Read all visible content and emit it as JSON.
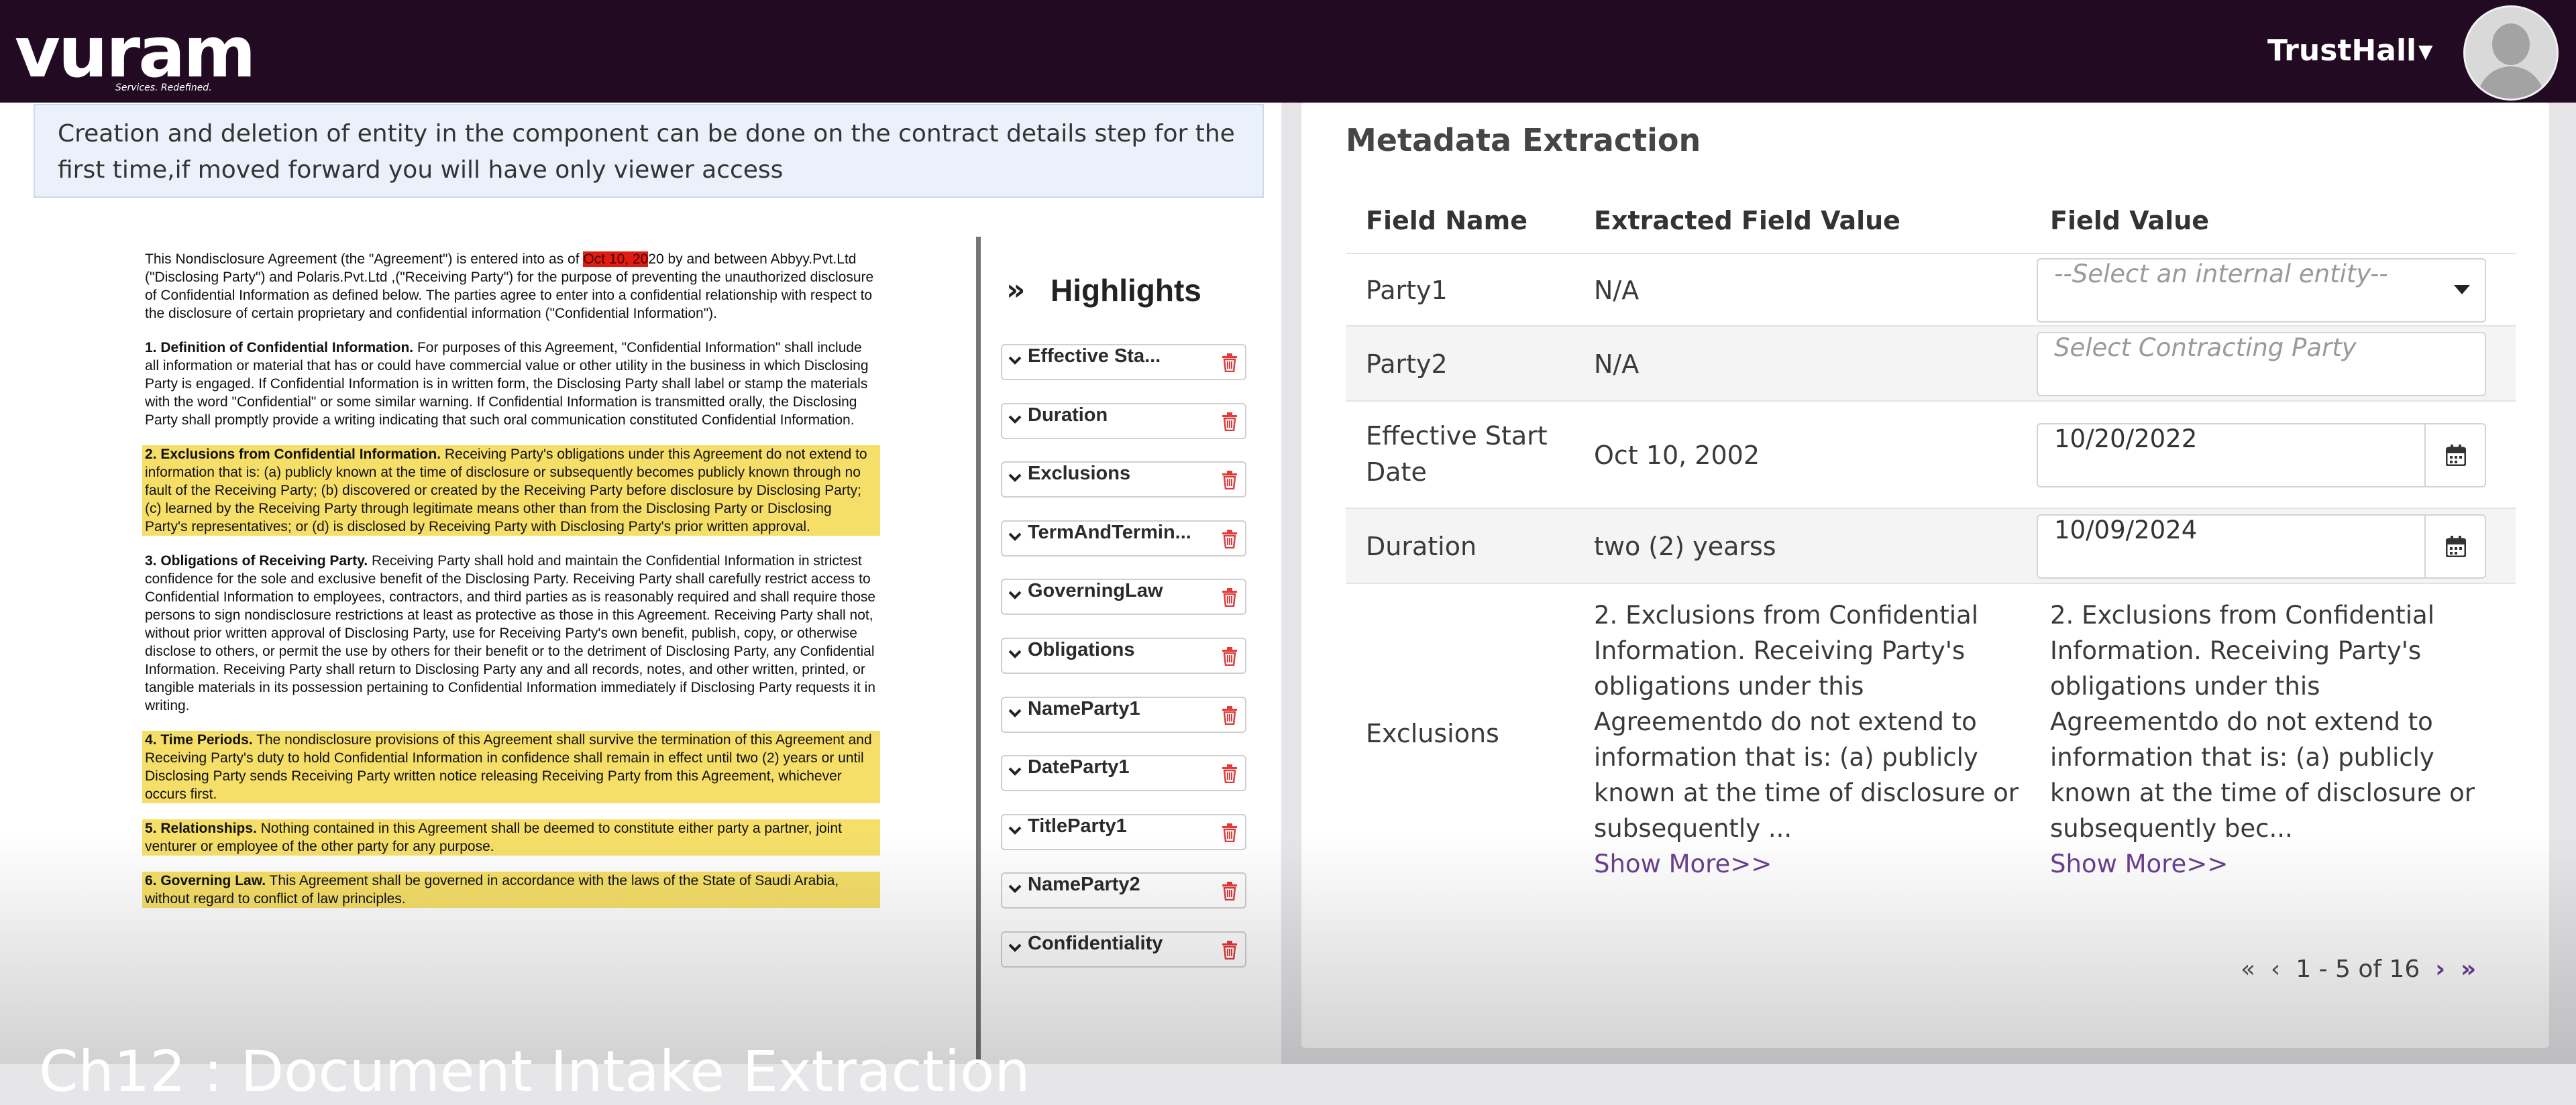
{
  "header": {
    "logo_text": "vuram",
    "logo_tagline": "Services. Redefined.",
    "user_name": "TrustHall"
  },
  "banner": {
    "text": "Creation and deletion of entity in the component can be done on the contract details step for the first time,if moved forward you will have only viewer access"
  },
  "document": {
    "intro_a": "This Nondisclosure Agreement (the \"Agreement\") is entered into as of ",
    "intro_date": "Oct 10, 20",
    "intro_b": "20 by and between Abbyy.Pvt.Ltd (\"Disclosing Party\") and Polaris.Pvt.Ltd ,(\"Receiving Party\") for the purpose of preventing the unauthorized disclosure of Confidential Information as defined below. The parties agree to enter into a confidential relationship with respect to the disclosure of certain proprietary and confidential information (\"Confidential Information\").",
    "s1_title": "1. Definition of Confidential Information.",
    "s1_body": " For purposes of this Agreement, \"Confidential Information\" shall include all information or material that has or could have commercial value or other utility in the business in which Disclosing Party is engaged. If Confidential Information is in written form, the Disclosing Party shall label or stamp the materials with the word \"Confidential\" or some similar warning. If Confidential Information is transmitted orally, the Disclosing Party shall promptly provide a writing indicating that such oral communication constituted Confidential Information.",
    "s2_title": "2. Exclusions from Confidential Information.",
    "s2_body": " Receiving Party's obligations under this Agreement do not extend to information that is: (a) publicly known at the time of disclosure or subsequently becomes publicly known through no fault of the Receiving Party; (b) discovered or created by the Receiving Party before disclosure by Disclosing Party; (c) learned by the Receiving Party through legitimate means other than from the Disclosing Party or Disclosing Party's representatives; or (d) is disclosed by Receiving Party with Disclosing Party's prior written approval.",
    "s3_title": "3. Obligations of Receiving Party.",
    "s3_body": " Receiving Party shall hold and maintain the Confidential Information in strictest confidence for the sole and exclusive benefit of the Disclosing Party. Receiving Party shall carefully restrict access to Confidential Information to employees, contractors, and third parties as is reasonably required and shall require those persons to sign nondisclosure restrictions at least as protective as those in this Agreement. Receiving Party shall not, without prior written approval of Disclosing Party, use for Receiving Party's own benefit, publish, copy, or otherwise disclose to others, or permit the use by others for their benefit or to the detriment of Disclosing Party, any Confidential Information. Receiving Party shall return to Disclosing Party any and all records, notes, and other written, printed, or tangible materials in its possession pertaining to Confidential Information immediately if Disclosing Party requests it in writing.",
    "s4_title": "4. Time Periods.",
    "s4_body": " The nondisclosure provisions of this Agreement shall survive the termination of this Agreement and Receiving Party's duty to hold Confidential Information in confidence shall remain in effect until two (2) years or until Disclosing Party sends Receiving Party written notice releasing Receiving Party from this Agreement, whichever occurs first.",
    "s5_title": "5. Relationships.",
    "s5_body": " Nothing contained in this Agreement shall be deemed to constitute either party a partner, joint venturer or employee of the other party for any purpose.",
    "s6_title": "6. Governing Law.",
    "s6_body": " This Agreement shall be governed in accordance with the laws of the State of Saudi Arabia, without regard to conflict of law principles."
  },
  "highlights": {
    "title": "Highlights",
    "items": [
      "Effective Sta...",
      "Duration",
      "Exclusions",
      "TermAndTermin...",
      "GoverningLaw",
      "Obligations",
      "NameParty1",
      "DateParty1",
      "TitleParty1",
      "NameParty2",
      "Confidentiality"
    ]
  },
  "metadata": {
    "title": "Metadata Extraction",
    "columns": [
      "Field Name",
      "Extracted Field Value",
      "Field Value"
    ],
    "rows": [
      {
        "field": "Party1",
        "extracted": "N/A",
        "value": "--Select an internal entity--"
      },
      {
        "field": "Party2",
        "extracted": "N/A",
        "value": "Select Contracting Party"
      },
      {
        "field": "Effective Start Date",
        "extracted": "Oct 10, 2002",
        "value": "10/20/2022"
      },
      {
        "field": "Duration",
        "extracted": "two (2) yearss",
        "value": "10/09/2024"
      },
      {
        "field": "Exclusions",
        "extracted": "2.    Exclusions from Confidential Information. Receiving Party's obligations under this Agreementdo do not extend to information that is: (a) publicly known at the time of disclosure or subsequently ...",
        "value": "2. Exclusions from Confidential Information. Receiving Party's obligations under this Agreementdo do not extend to information that is: (a) publicly known at the time of disclosure or subsequently bec...",
        "show_more": "Show More>>"
      }
    ],
    "pagination": {
      "range": "1 - 5 of 16",
      "first": "«",
      "prev": "‹",
      "next": "›",
      "last": "»"
    }
  },
  "caption": {
    "text": "Ch12 : Document Intake Extraction"
  },
  "colors": {
    "topbar": "#220b22",
    "highlight": "#f6df69",
    "accent": "#6a3f90",
    "redmark": "#e01b10"
  },
  "icons": [
    "chevron-down-icon",
    "trash-icon",
    "calendar-icon",
    "double-chevron-right-icon",
    "dropdown-caret-icon",
    "avatar-icon"
  ]
}
